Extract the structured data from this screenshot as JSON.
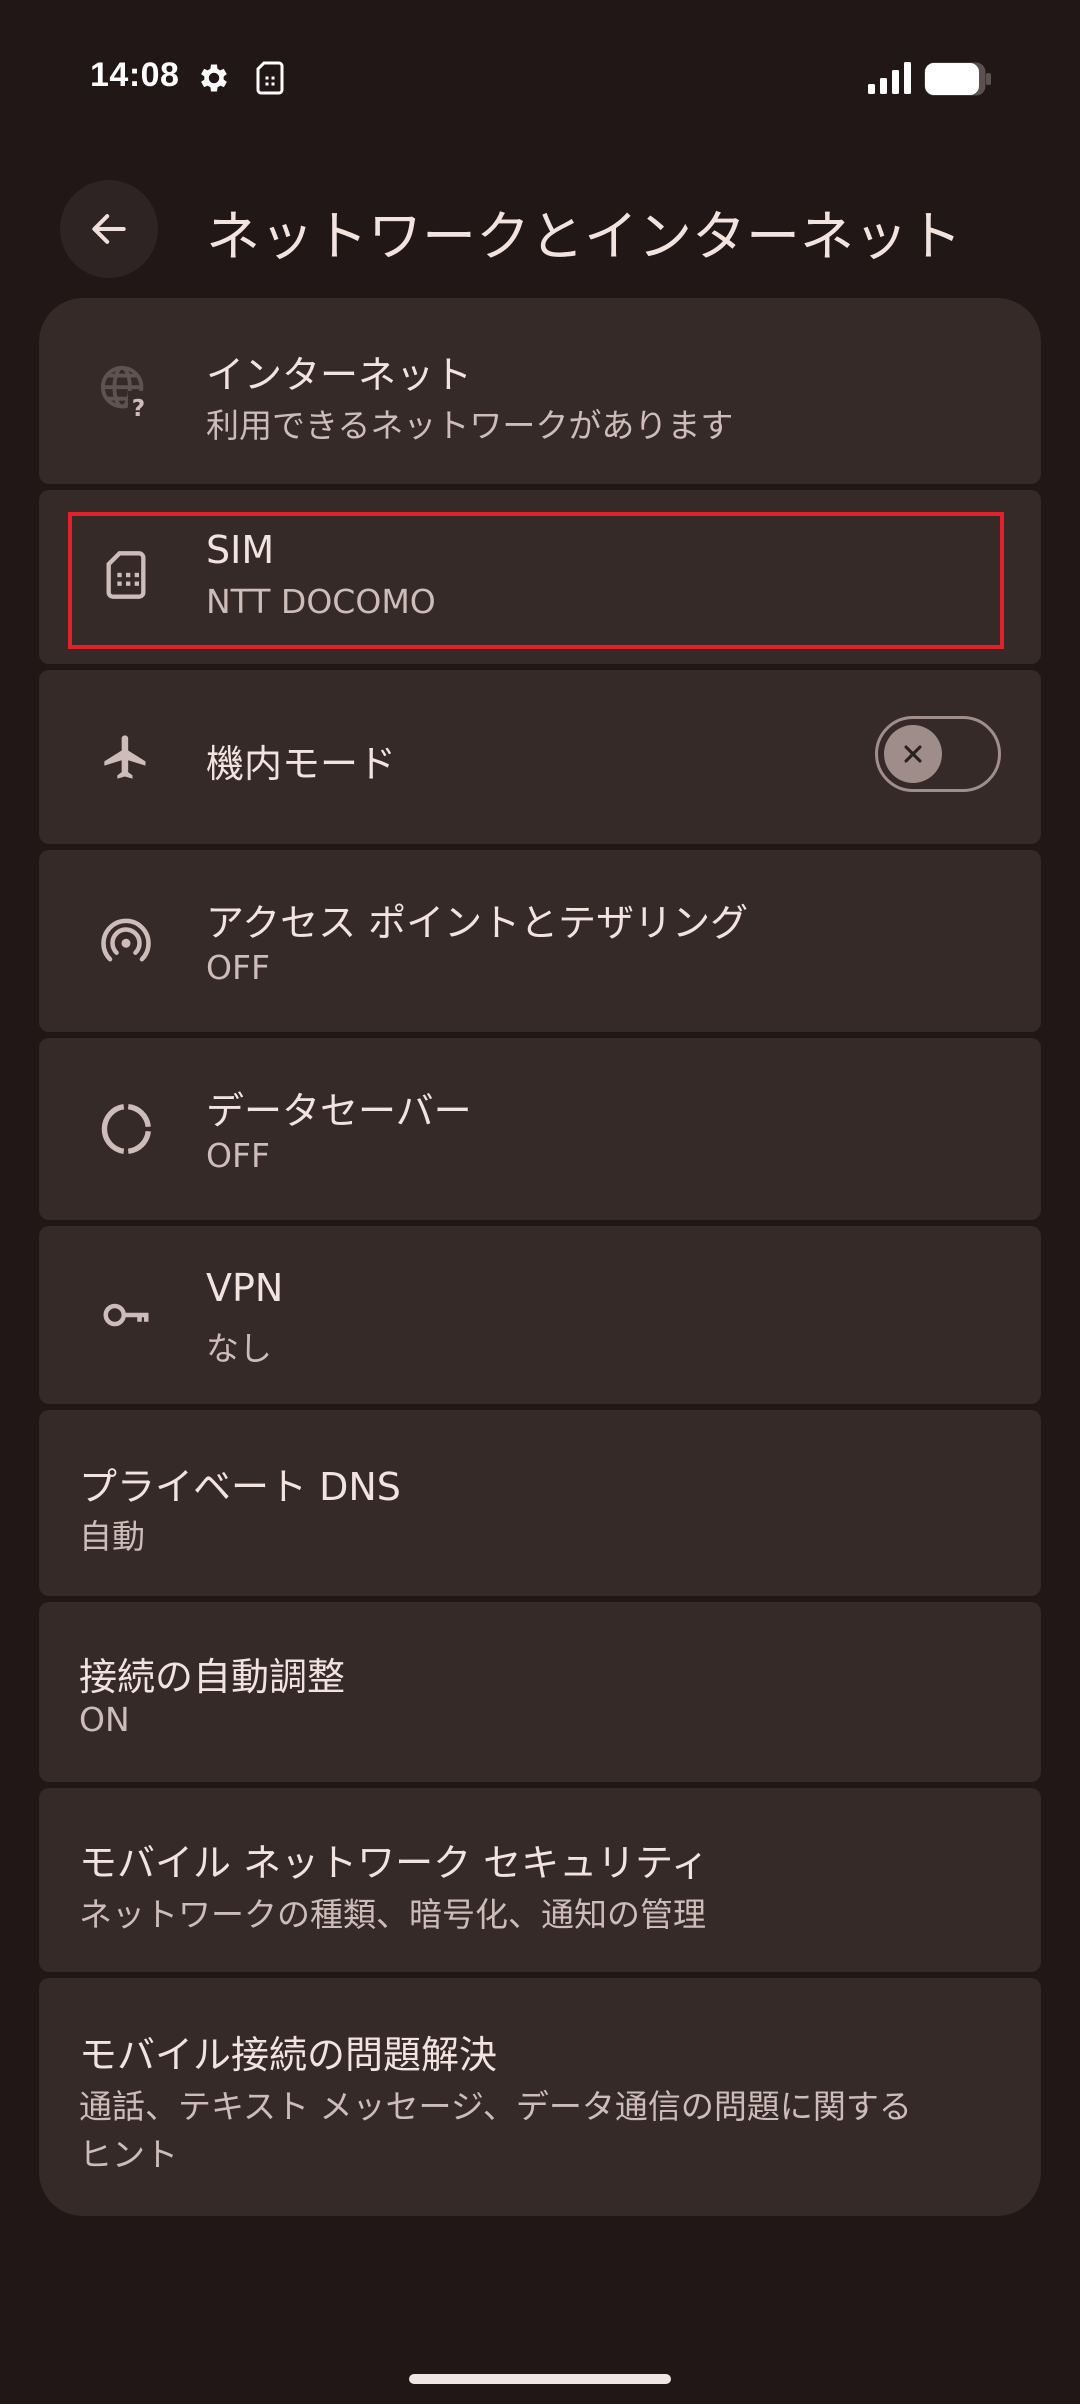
{
  "status_bar": {
    "time": "14:08",
    "icons": [
      "settings-icon",
      "sim-icon",
      "signal-icon",
      "battery-icon"
    ]
  },
  "header": {
    "back_icon": "arrow-back-icon",
    "title": "ネットワークとインターネット"
  },
  "items": [
    {
      "title": "インターネット",
      "subtitle": "利用できるネットワークがあります",
      "icon": "globe-question-icon"
    },
    {
      "title": "SIM",
      "subtitle": "NTT DOCOMO",
      "icon": "sim-card-icon"
    },
    {
      "title": "機内モード",
      "icon": "airplane-icon",
      "toggle": "off"
    },
    {
      "title": "アクセス ポイントとテザリング",
      "subtitle": "OFF",
      "icon": "hotspot-icon"
    },
    {
      "title": "データセーバー",
      "subtitle": "OFF",
      "icon": "data-saver-icon"
    },
    {
      "title": "VPN",
      "subtitle": "なし",
      "icon": "vpn-key-icon"
    },
    {
      "title": "プライベート DNS",
      "subtitle": "自動"
    },
    {
      "title": "接続の自動調整",
      "subtitle": "ON"
    },
    {
      "title": "モバイル ネットワーク セキュリティ",
      "subtitle": "ネットワークの種類、暗号化、通知の管理"
    },
    {
      "title": "モバイル接続の問題解決",
      "subtitle_line1": "通話、テキスト メッセージ、データ通信の問題に関する",
      "subtitle_line2": "ヒント"
    }
  ],
  "colors": {
    "background": "#201716",
    "card": "#362a28",
    "highlight_border": "#e0222b"
  }
}
